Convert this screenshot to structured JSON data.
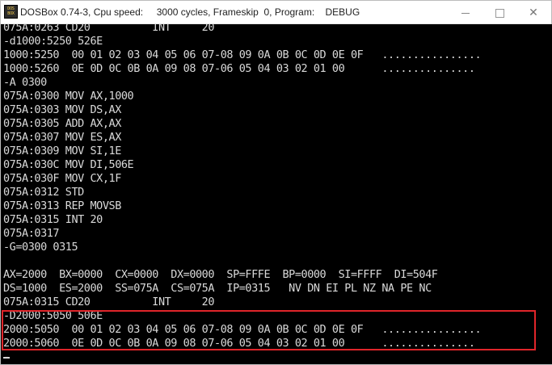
{
  "window": {
    "icon_text": "DOS BOX",
    "title": "DOSBox 0.74-3, Cpu speed:     3000 cycles, Frameskip  0, Program:    DEBUG"
  },
  "console": {
    "lines": [
      "075A:0263 CD20          INT     20",
      "-d1000:5250 526E",
      "1000:5250  00 01 02 03 04 05 06 07-08 09 0A 0B 0C 0D 0E 0F   ................",
      "1000:5260  0E 0D 0C 0B 0A 09 08 07-06 05 04 03 02 01 00      ...............",
      "-A 0300",
      "075A:0300 MOV AX,1000",
      "075A:0303 MOV DS,AX",
      "075A:0305 ADD AX,AX",
      "075A:0307 MOV ES,AX",
      "075A:0309 MOV SI,1E",
      "075A:030C MOV DI,506E",
      "075A:030F MOV CX,1F",
      "075A:0312 STD",
      "075A:0313 REP MOVSB",
      "075A:0315 INT 20",
      "075A:0317",
      "-G=0300 0315",
      "",
      "AX=2000  BX=0000  CX=0000  DX=0000  SP=FFFE  BP=0000  SI=FFFF  DI=504F",
      "DS=1000  ES=2000  SS=075A  CS=075A  IP=0315   NV DN EI PL NZ NA PE NC",
      "075A:0315 CD20          INT     20",
      "-D2000:5050 506E",
      "2000:5050  00 01 02 03 04 05 06 07-08 09 0A 0B 0C 0D 0E 0F   ................",
      "2000:5060  0E 0D 0C 0B 0A 09 08 07-06 05 04 03 02 01 00      ...............",
      "-"
    ]
  },
  "colors": {
    "background": "#000000",
    "text": "#d9d9d9",
    "highlight_border": "#e0252a"
  }
}
